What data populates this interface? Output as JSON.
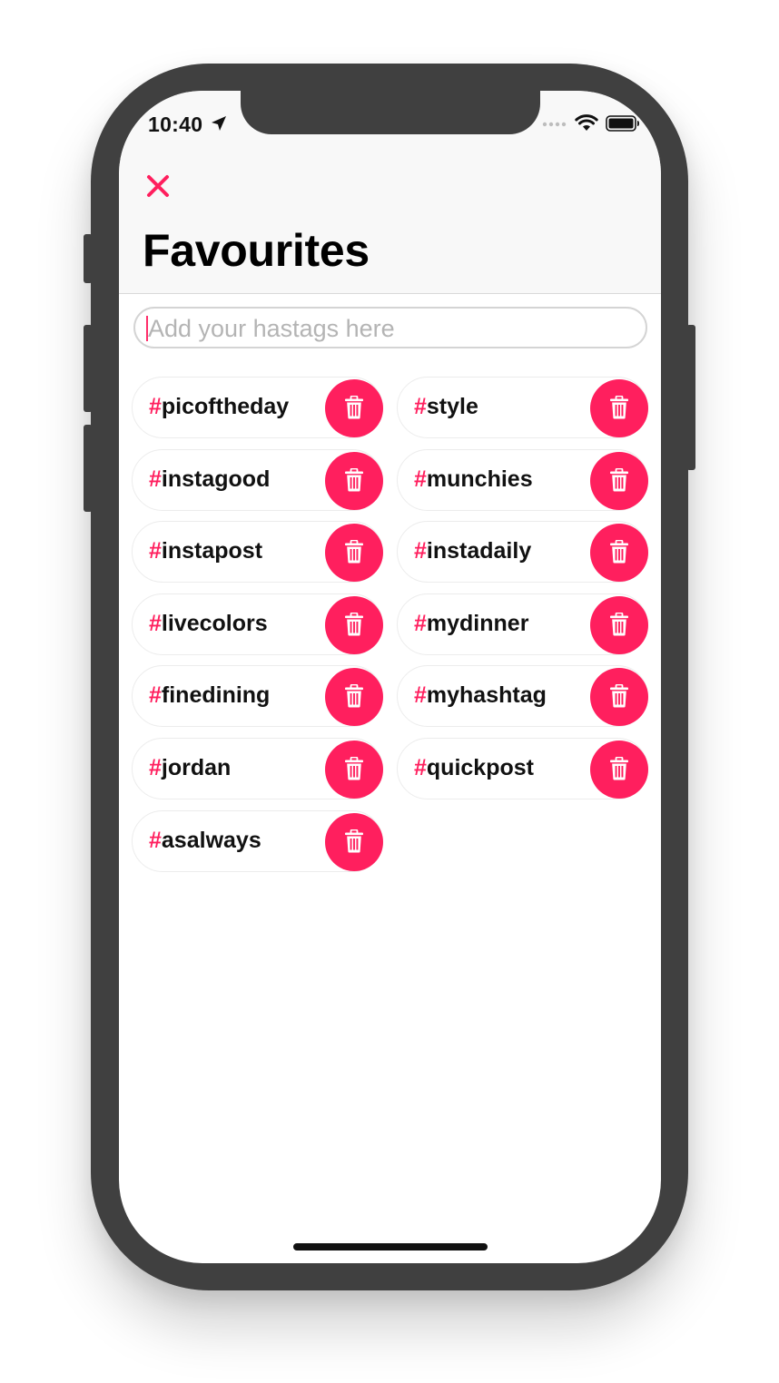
{
  "status": {
    "time": "10:40"
  },
  "header": {
    "title": "Favourites"
  },
  "search": {
    "placeholder": "Add your hastags here",
    "value": ""
  },
  "hashtag_symbol": "#",
  "tags": [
    "picoftheday",
    "style",
    "instagood",
    "munchies",
    "instapost",
    "instadaily",
    "livecolors",
    "mydinner",
    "finedining",
    "myhashtag",
    "jordan",
    "quickpost",
    "asalways"
  ],
  "colors": {
    "accent": "#ff1f5e",
    "frame": "#404040",
    "header_bg": "#f8f8f8"
  },
  "icons": {
    "close": "close-icon",
    "delete": "trash-icon"
  }
}
